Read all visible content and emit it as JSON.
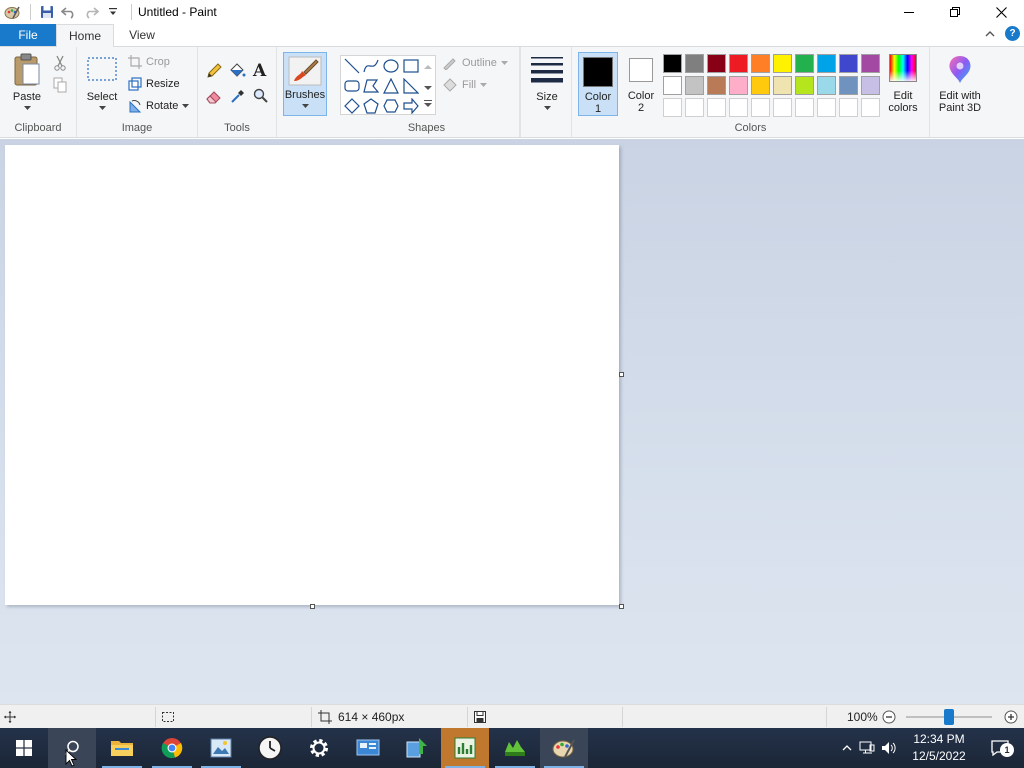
{
  "window": {
    "title": "Untitled - Paint"
  },
  "tabs": {
    "file": "File",
    "home": "Home",
    "view": "View"
  },
  "ribbon": {
    "clipboard": {
      "label": "Clipboard",
      "paste": "Paste"
    },
    "image": {
      "label": "Image",
      "select": "Select",
      "crop": "Crop",
      "resize": "Resize",
      "rotate": "Rotate"
    },
    "tools": {
      "label": "Tools"
    },
    "brushes": {
      "label": "Brushes"
    },
    "shapes": {
      "label": "Shapes",
      "outline": "Outline",
      "fill": "Fill"
    },
    "size": {
      "label": "Size"
    },
    "colors": {
      "label": "Colors",
      "color1_line1": "Color",
      "color1_line2": "1",
      "color2_line1": "Color",
      "color2_line2": "2",
      "edit_line1": "Edit",
      "edit_line2": "colors",
      "paint3d_line1": "Edit with",
      "paint3d_line2": "Paint 3D",
      "color1": "#000000",
      "color2": "#ffffff",
      "palette_row1": [
        "#000000",
        "#7f7f7f",
        "#880015",
        "#ed1c24",
        "#ff7f27",
        "#fff200",
        "#22b14c",
        "#00a2e8",
        "#3f48cc",
        "#a349a4"
      ],
      "palette_row2": [
        "#ffffff",
        "#c3c3c3",
        "#b97a57",
        "#ffaec9",
        "#ffc90e",
        "#efe4b0",
        "#b5e61d",
        "#99d9ea",
        "#7092be",
        "#c8bfe7"
      ]
    }
  },
  "statusbar": {
    "dimensions": "614 × 460px",
    "zoom": "100%",
    "zoom_fraction": 0.5
  },
  "taskbar": {
    "time": "12:34 PM",
    "date": "12/5/2022",
    "notifications": "1"
  }
}
